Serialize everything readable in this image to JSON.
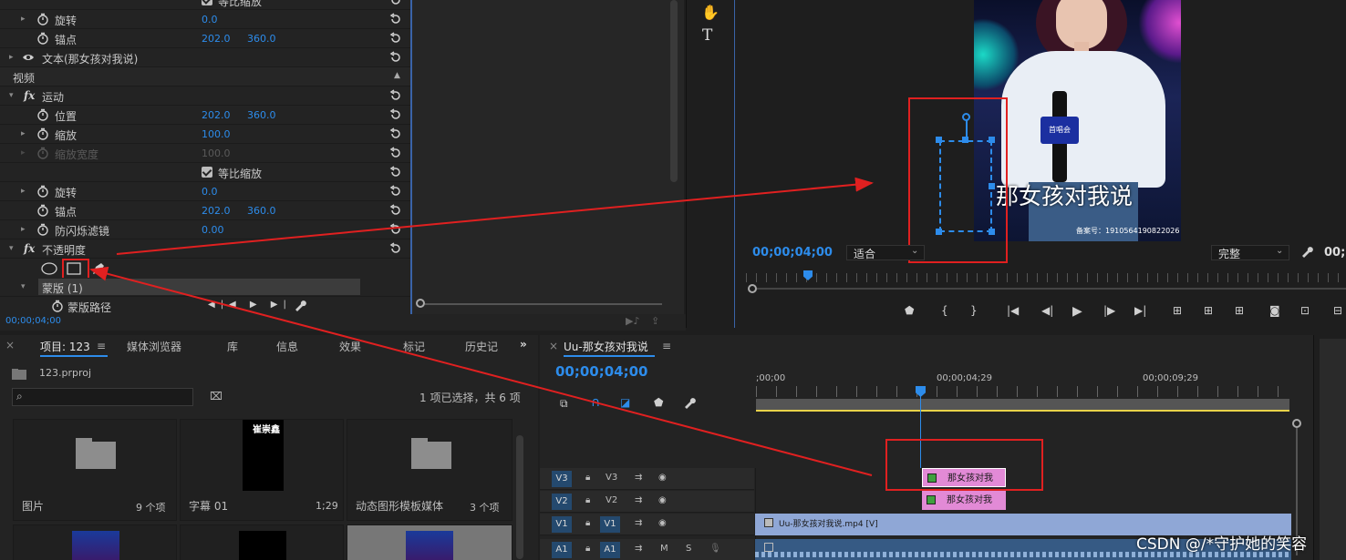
{
  "effect_controls": {
    "rows": [
      {
        "label": "等比缩放",
        "type": "checkbox",
        "checked": true
      },
      {
        "label": "旋转",
        "v1": "0.0"
      },
      {
        "label": "锚点",
        "v1": "202.0",
        "v2": "360.0"
      },
      {
        "label": "文本(那女孩对我说)",
        "type": "text-layer"
      },
      {
        "label": "视频",
        "type": "section"
      },
      {
        "label": "运动",
        "type": "fx"
      },
      {
        "label": "位置",
        "v1": "202.0",
        "v2": "360.0"
      },
      {
        "label": "缩放",
        "v1": "100.0"
      },
      {
        "label": "缩放宽度",
        "v1": "100.0",
        "disabled": true
      },
      {
        "label": "等比缩放",
        "type": "checkbox",
        "checked": true
      },
      {
        "label": "旋转",
        "v1": "0.0"
      },
      {
        "label": "锚点",
        "v1": "202.0",
        "v2": "360.0"
      },
      {
        "label": "防闪烁滤镜",
        "v1": "0.00"
      },
      {
        "label": "不透明度",
        "type": "fx"
      }
    ],
    "mask_label": "蒙版 (1)",
    "mask_path_label": "蒙版路径",
    "timecode": "00;00;04;00"
  },
  "program": {
    "timecode": "00;00;04;00",
    "fit_label": "适合",
    "quality_label": "完整",
    "right_time": "00;",
    "video_caption": "那女孩对我说",
    "video_footer": "备案号：1910564190822026",
    "mic_text": "首唱会"
  },
  "project_panel": {
    "tabs": [
      "项目: 123",
      "媒体浏览器",
      "库",
      "信息",
      "效果",
      "标记",
      "历史记"
    ],
    "project_file": "123.prproj",
    "selection_status": "1 项已选择，共 6 项",
    "items": [
      {
        "name": "图片",
        "meta": "9 个项"
      },
      {
        "name": "字幕 01",
        "meta": "1;29",
        "thumb_text": "崔崇鑫"
      },
      {
        "name": "动态图形模板媒体",
        "meta": "3 个项"
      }
    ]
  },
  "timeline": {
    "sequence_name": "Uu-那女孩对我说",
    "timecode": "00;00;04;00",
    "ruler": [
      ";00;00",
      "00;00;04;29",
      "00;00;09;29"
    ],
    "tracks": [
      {
        "id": "V3",
        "label": "V3"
      },
      {
        "id": "V2",
        "label": "V2"
      },
      {
        "id": "V1",
        "label": "V1",
        "src": "V1"
      },
      {
        "id": "A1",
        "label": "A1",
        "src": "A1"
      }
    ],
    "clips": {
      "v3": "那女孩对我",
      "v2": "那女孩对我",
      "v1": "Uu-那女孩对我说.mp4 [V]"
    },
    "audio_labels": {
      "m": "M",
      "s": "S"
    }
  },
  "watermark": "CSDN @/*守护她的笑容",
  "colors": {
    "accent_blue": "#2d8ceb",
    "annotation_red": "#e02020",
    "clip_pink": "#e28ad6",
    "clip_blue": "#8fa7d6",
    "playhead": "#2d8ceb"
  }
}
